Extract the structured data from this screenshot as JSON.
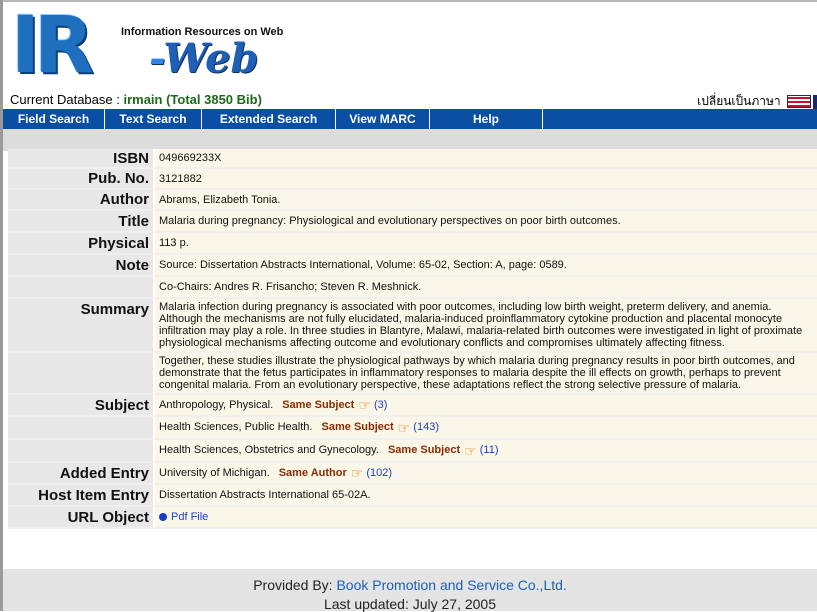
{
  "header": {
    "logo_ir": "IR",
    "logo_dash": "-",
    "logo_web": "Web",
    "logo_tagline": "Information Resources on Web",
    "current_db_label": "Current Database :",
    "current_db_name": "irmain (Total 3850 Bib)",
    "lang_switch": "เปลี่ยนเป็นภาษา",
    "lang_flag_icon": "uk-flag-icon"
  },
  "nav": {
    "items": [
      "Field Search",
      "Text Search",
      "Extended Search",
      "View MARC",
      "Help"
    ]
  },
  "record": {
    "isbn_label": "ISBN",
    "isbn": "049669233X",
    "pubno_label": "Pub. No.",
    "pubno": "3121882",
    "author_label": "Author",
    "author": "Abrams, Elizabeth Tonia.",
    "title_label": "Title",
    "title": "Malaria during pregnancy: Physiological and evolutionary perspectives on poor birth outcomes.",
    "physical_label": "Physical",
    "physical": "113 p.",
    "note_label": "Note",
    "notes": [
      "Source: Dissertation Abstracts International, Volume: 65-02, Section: A, page: 0589.",
      "Co-Chairs: Andres R. Frisancho; Steven R. Meshnick."
    ],
    "summary_label": "Summary",
    "summaries": [
      "Malaria infection during pregnancy is associated with poor outcomes, including low birth weight, preterm delivery, and anemia. Although the mechanisms are not fully elucidated, malaria-induced proinflammatory cytokine production and placental monocyte infiltration may play a role. In three studies in Blantyre, Malawi, malaria-related birth outcomes were investigated in light of proximate physiological mechanisms affecting outcome and evolutionary conflicts and compromises ultimately affecting fitness.",
      "Together, these studies illustrate the physiological pathways by which malaria during pregnancy results in poor birth outcomes, and demonstrate that the fetus participates in inflammatory responses to malaria despite the ill effects on growth, perhaps to prevent congenital malaria. From an evolutionary perspective, these adaptations reflect the strong selective pressure of malaria."
    ],
    "subject_label": "Subject",
    "same_subject_label": "Same Subject",
    "subjects": [
      {
        "text": "Anthropology, Physical.",
        "count": "(3)"
      },
      {
        "text": "Health Sciences, Public Health.",
        "count": "(143)"
      },
      {
        "text": "Health Sciences, Obstetrics and Gynecology.",
        "count": "(11)"
      }
    ],
    "added_entry_label": "Added Entry",
    "added_entry": "University of Michigan.",
    "same_author_label": "Same Author",
    "added_entry_count": "(102)",
    "host_item_label": "Host Item Entry",
    "host_item": "Dissertation Abstracts International 65-02A.",
    "url_object_label": "URL Object",
    "url_object_link": "Pdf File"
  },
  "footer": {
    "provided_label": "Provided By:",
    "provided_org": "Book Promotion and Service Co.,Ltd.",
    "last_updated": "Last updated: July 27, 2005"
  }
}
